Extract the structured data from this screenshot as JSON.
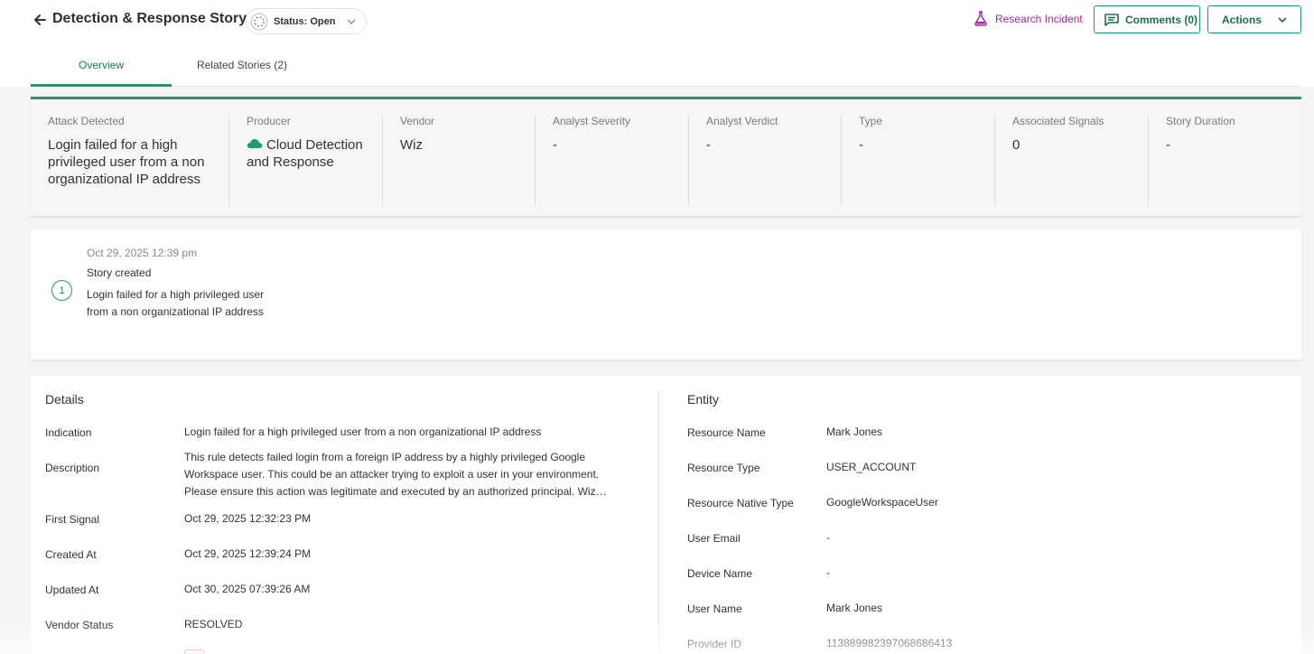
{
  "header": {
    "title": "Detection & Response Story",
    "status_label": "Status: Open",
    "research_label": "Research Incident",
    "comments_label": "Comments (0)",
    "actions_label": "Actions"
  },
  "tabs": [
    {
      "label": "Overview",
      "active": true
    },
    {
      "label": "Related Stories (2)",
      "active": false
    }
  ],
  "summary": {
    "attack_detected": {
      "label": "Attack Detected",
      "value": "Login failed for a high privileged user from a non organizational IP address"
    },
    "producer": {
      "label": "Producer",
      "value": "Cloud Detection and Response",
      "icon": "cloud-icon"
    },
    "vendor": {
      "label": "Vendor",
      "value": "Wiz"
    },
    "analyst_severity": {
      "label": "Analyst Severity",
      "value": "-"
    },
    "analyst_verdict": {
      "label": "Analyst Verdict",
      "value": "-"
    },
    "type": {
      "label": "Type",
      "value": "-"
    },
    "associated_signals": {
      "label": "Associated Signals",
      "value": "0"
    },
    "story_duration": {
      "label": "Story Duration",
      "value": "-"
    }
  },
  "timeline": {
    "step": "1",
    "date": "Oct 29, 2025 12:39 pm",
    "event": "Story created",
    "description": "Login failed for a high privileged user from a non organizational IP address"
  },
  "details": {
    "title": "Details",
    "rows": [
      {
        "label": "Indication",
        "value": "Login failed for a high privileged user from a non organizational IP address"
      },
      {
        "label": "Description",
        "value": "This rule detects failed login from a foreign IP address by a highly privileged Google Workspace user. This could be an attacker trying to exploit a user in your environment. Please ensure this action was legitimate and executed by an authorized principal. Wiz…"
      },
      {
        "label": "First Signal",
        "value": "Oct 29, 2025 12:32:23 PM"
      },
      {
        "label": "Created At",
        "value": "Oct 29, 2025 12:39:24 PM"
      },
      {
        "label": "Updated At",
        "value": "Oct 30, 2025 07:39:26 AM"
      },
      {
        "label": "Vendor Status",
        "value": "RESOLVED"
      }
    ]
  },
  "entity": {
    "title": "Entity",
    "rows": [
      {
        "label": "Resource Name",
        "value": "Mark Jones"
      },
      {
        "label": "Resource Type",
        "value": "USER_ACCOUNT"
      },
      {
        "label": "Resource Native Type",
        "value": "GoogleWorkspaceUser"
      },
      {
        "label": "User Email",
        "value": "-"
      },
      {
        "label": "Device Name",
        "value": "-"
      },
      {
        "label": "User Name",
        "value": "Mark Jones"
      },
      {
        "label": "Provider ID",
        "value": "113889982397068686413"
      }
    ]
  },
  "colors": {
    "accent": "#1a9c6b",
    "accent_text": "#1c6f4e",
    "research": "#9c2a9c"
  }
}
